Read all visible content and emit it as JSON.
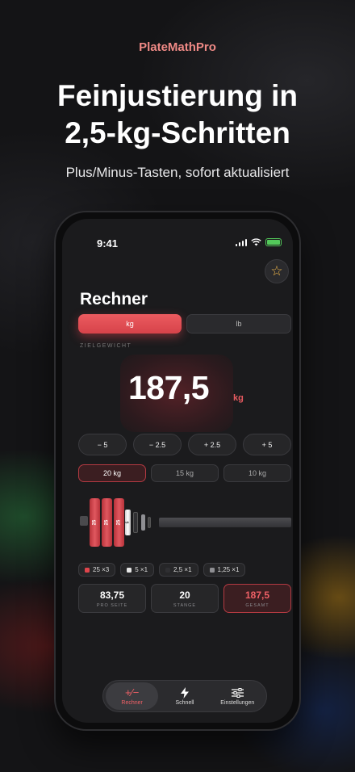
{
  "brand": "PlateMathPro",
  "headline_line1": "Feinjustierung in",
  "headline_line2": "2,5-kg-Schritten",
  "subline": "Plus/Minus-Tasten, sofort aktualisiert",
  "status": {
    "time": "9:41"
  },
  "screen": {
    "title": "Rechner",
    "units": [
      {
        "label": "kg",
        "active": true
      },
      {
        "label": "lb",
        "active": false
      }
    ],
    "target_label": "ZIELGEWICHT",
    "target_value": "187,5",
    "target_unit": "kg",
    "steps": [
      "− 5",
      "− 2.5",
      "+ 2.5",
      "+ 5"
    ],
    "bars": [
      {
        "label": "20 kg",
        "active": true
      },
      {
        "label": "15 kg",
        "active": false
      },
      {
        "label": "10 kg",
        "active": false
      }
    ],
    "plates": {
      "big_label": "25",
      "small_label": "5"
    },
    "chips": [
      {
        "label": "25 ×3",
        "color": "#e0454c"
      },
      {
        "label": "5 ×1",
        "color": "#e6e6e6"
      },
      {
        "label": "2,5 ×1",
        "color": "#2f2f32"
      },
      {
        "label": "1,25 ×1",
        "color": "#8f8f93"
      }
    ],
    "summary": [
      {
        "value": "83,75",
        "label": "PRO SEITE"
      },
      {
        "value": "20",
        "label": "STANGE"
      },
      {
        "value": "187,5",
        "label": "GESAMT"
      }
    ],
    "tabs": [
      {
        "label": "Rechner",
        "icon": "plus-minus-icon",
        "active": true
      },
      {
        "label": "Schnell",
        "icon": "bolt-icon",
        "active": false
      },
      {
        "label": "Einstellungen",
        "icon": "sliders-icon",
        "active": false
      }
    ]
  },
  "colors": {
    "accent": "#e95a60",
    "brand": "#f08a86",
    "background": "#141416"
  }
}
